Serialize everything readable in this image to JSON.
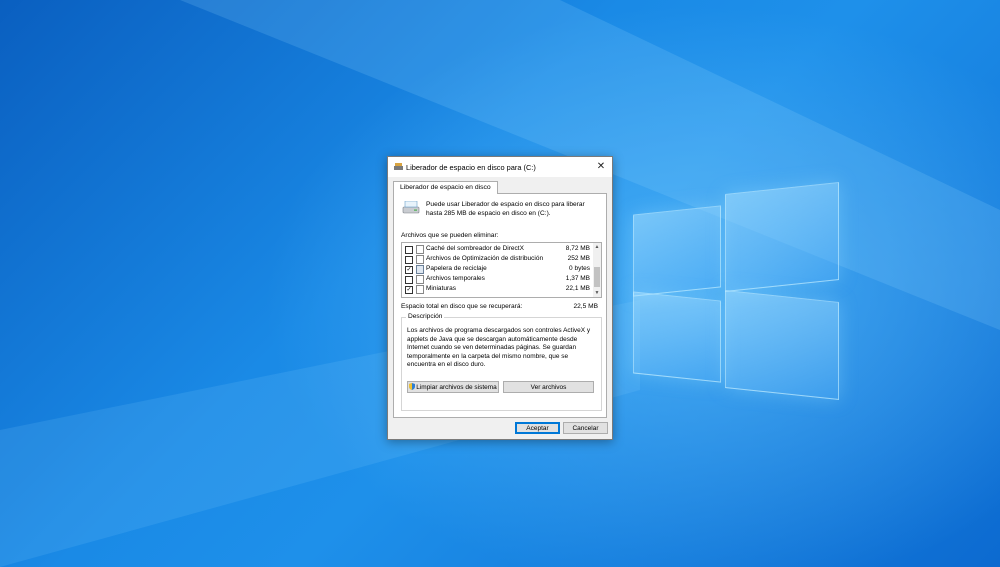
{
  "dialog": {
    "title": "Liberador de espacio en disco para  (C:)",
    "close_glyph": "✕",
    "tab_label": "Liberador de espacio en disco",
    "intro_text": "Puede usar Liberador de espacio en disco para liberar hasta 285 MB de espacio en disco en  (C:).",
    "list_label": "Archivos que se pueden eliminar:",
    "items": [
      {
        "name": "Caché del sombreador de DirectX",
        "size": "8,72 MB",
        "checked": false,
        "icon": "file-icon"
      },
      {
        "name": "Archivos de Optimización de distribución",
        "size": "252 MB",
        "checked": false,
        "icon": "file-icon"
      },
      {
        "name": "Papelera de reciclaje",
        "size": "0 bytes",
        "checked": true,
        "icon": "recycle-bin-icon"
      },
      {
        "name": "Archivos temporales",
        "size": "1,37 MB",
        "checked": false,
        "icon": "file-icon"
      },
      {
        "name": "Miniaturas",
        "size": "22,1 MB",
        "checked": true,
        "icon": "file-icon"
      }
    ],
    "total_label": "Espacio total en disco que se recuperará:",
    "total_value": "22,5 MB",
    "description_title": "Descripción",
    "description_text": "Los archivos de programa descargados son controles ActiveX y applets de Java que se descargan automáticamente desde Internet cuando se ven determinadas páginas. Se guardan temporalmente en la carpeta del mismo nombre, que se encuentra en el disco duro.",
    "clean_system_label": "Limpiar archivos de sistema",
    "view_files_label": "Ver archivos",
    "ok_label": "Aceptar",
    "cancel_label": "Cancelar"
  },
  "colors": {
    "accent": "#0078d7",
    "desktop": "#1a8ae6"
  }
}
